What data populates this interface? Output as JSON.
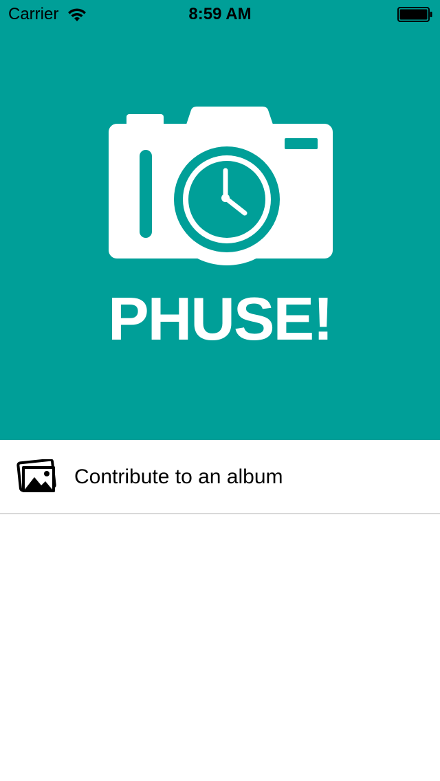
{
  "status_bar": {
    "carrier": "Carrier",
    "time": "8:59 AM",
    "wifi_icon": "wifi-icon",
    "battery_icon": "battery-icon"
  },
  "hero": {
    "background_color": "#009f98",
    "logo_icon": "camera-clock-logo",
    "logo_text": "PHUSE!"
  },
  "list": {
    "items": [
      {
        "icon": "photo-album-icon",
        "label": "Contribute to an album"
      }
    ]
  }
}
